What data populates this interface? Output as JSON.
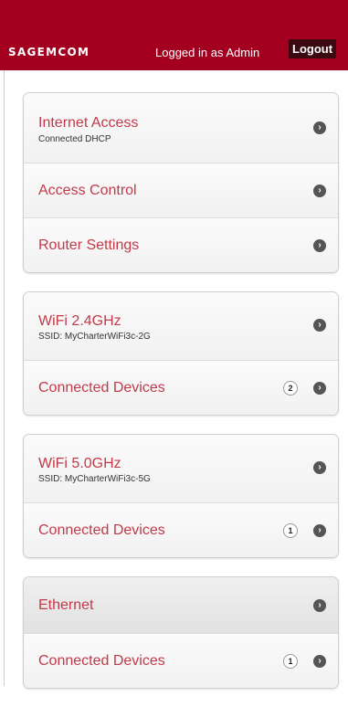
{
  "header": {
    "logo": "SAGEMCOM",
    "logged_in_text": "Logged in as Admin",
    "logout_label": "Logout",
    "colors": {
      "brand": "#a3001f",
      "logout_bg": "#3a0a10"
    }
  },
  "cards": [
    {
      "rows": [
        {
          "title": "Internet Access",
          "subtitle": "Connected DHCP"
        },
        {
          "title": "Access Control"
        },
        {
          "title": "Router Settings"
        }
      ]
    },
    {
      "rows": [
        {
          "title": "WiFi 2.4GHz",
          "subtitle": "SSID: MyCharterWiFi3c-2G"
        },
        {
          "title": "Connected Devices",
          "count": "2"
        }
      ]
    },
    {
      "rows": [
        {
          "title": "WiFi 5.0GHz",
          "subtitle": "SSID: MyCharterWiFi3c-5G"
        },
        {
          "title": "Connected Devices",
          "count": "1"
        }
      ]
    },
    {
      "rows": [
        {
          "title": "Ethernet"
        },
        {
          "title": "Connected Devices",
          "count": "1"
        }
      ]
    }
  ],
  "icons": {
    "row_arrow": "chevron-right-circle-icon",
    "count_badge": "count-badge"
  },
  "theme": {
    "title_color": "#c23a4a",
    "arrow_color": "#555555"
  }
}
